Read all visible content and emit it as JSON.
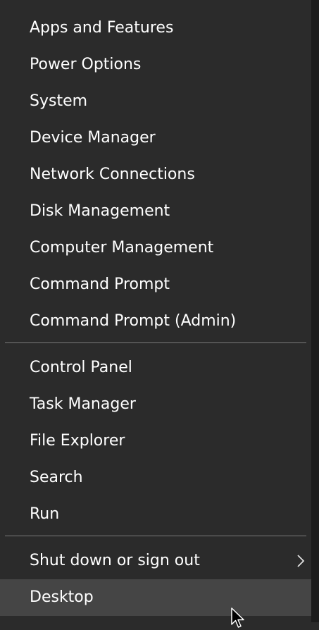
{
  "groups": [
    {
      "items": [
        {
          "label": "Apps and Features"
        },
        {
          "label": "Power Options"
        },
        {
          "label": "System"
        },
        {
          "label": "Device Manager"
        },
        {
          "label": "Network Connections"
        },
        {
          "label": "Disk Management"
        },
        {
          "label": "Computer Management"
        },
        {
          "label": "Command Prompt"
        },
        {
          "label": "Command Prompt (Admin)"
        }
      ]
    },
    {
      "items": [
        {
          "label": "Control Panel"
        },
        {
          "label": "Task Manager"
        },
        {
          "label": "File Explorer"
        },
        {
          "label": "Search"
        },
        {
          "label": "Run"
        }
      ]
    },
    {
      "items": [
        {
          "label": "Shut down or sign out",
          "submenu_icon": "chevron-right-icon"
        },
        {
          "label": "Desktop",
          "state": "hovered"
        }
      ]
    }
  ],
  "colors": {
    "background": "#2b2b2b",
    "hover": "#454545",
    "text": "#ffffff",
    "separator": "#7a7a7a"
  }
}
